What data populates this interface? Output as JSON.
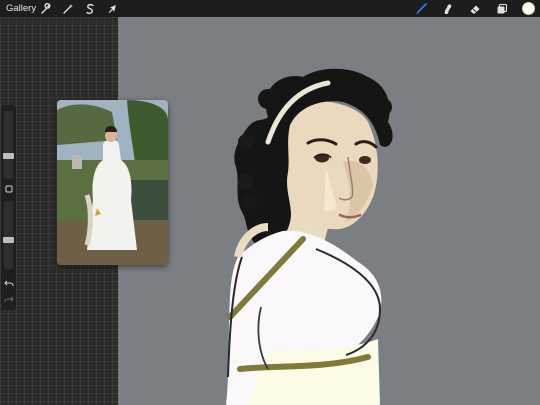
{
  "app": {
    "gallery_label": "Gallery"
  },
  "toolbar_left": [
    {
      "name": "actions",
      "icon": "wrench-icon"
    },
    {
      "name": "adjustments",
      "icon": "magic-wand-icon"
    },
    {
      "name": "selection",
      "icon": "selection-s-icon"
    },
    {
      "name": "transform",
      "icon": "arrow-cursor-icon"
    }
  ],
  "toolbar_right": [
    {
      "name": "brush",
      "icon": "brush-icon",
      "active": true
    },
    {
      "name": "smudge",
      "icon": "smudge-icon"
    },
    {
      "name": "eraser",
      "icon": "eraser-icon"
    },
    {
      "name": "layers",
      "icon": "layers-icon"
    }
  ],
  "colors": {
    "accent": "#2f7df6",
    "current_color": "#fffbe9",
    "canvas_bg": "#7b7e83",
    "grid_bg": "#2c2c2c"
  },
  "sidebar": {
    "brush_size_level": 0.25,
    "opacity_level": 0.55,
    "buttons": [
      "modify-square-icon",
      "undo-icon",
      "redo-icon"
    ]
  },
  "reference_image": {
    "subject": "portrait-painting-woman-white-dress"
  }
}
